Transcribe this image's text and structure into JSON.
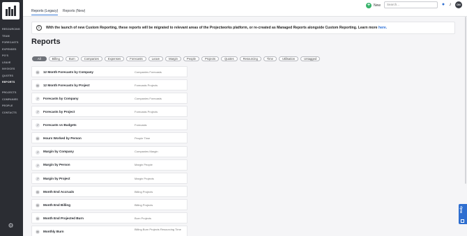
{
  "sidebar": {
    "logo": "pwl",
    "items": [
      {
        "label": "RESOURCING",
        "active": false
      },
      {
        "label": "TEAM",
        "active": false
      },
      {
        "label": "FORECASTS",
        "active": false
      },
      {
        "label": "EXPENSES",
        "active": false
      },
      {
        "label": "PO'S",
        "active": false
      },
      {
        "label": "LEAVE",
        "active": false
      },
      {
        "label": "INVOICES",
        "active": false
      },
      {
        "label": "QUOTES",
        "active": false
      },
      {
        "label": "REPORTS",
        "active": true
      }
    ],
    "items2": [
      {
        "label": "PROJECTS"
      },
      {
        "label": "COMPANIES"
      },
      {
        "label": "PEOPLE"
      },
      {
        "label": "CONTACTS"
      }
    ],
    "settings_icon": "gear-icon"
  },
  "tabs": [
    {
      "label": "Reports (Legacy)",
      "active": true
    },
    {
      "label": "Reports (New)",
      "active": false
    }
  ],
  "topbar": {
    "new_label": "New",
    "search_placeholder": "Search...",
    "user_initials": "DN"
  },
  "banner": {
    "text": "With the launch of new Custom Reporting, these reports will be migrated to relevant areas of the Projectworks platform, or re-created as Managed Reports alongside Custom Reporting. Learn more",
    "link": "here."
  },
  "page_title": "Reports",
  "filters": [
    "All",
    "Billing",
    "Burn",
    "Companies",
    "Expenses",
    "Forecasts",
    "Leave",
    "Margin",
    "People",
    "Projects",
    "Quotes",
    "Resourcing",
    "Time",
    "Utilisation",
    "Untagged"
  ],
  "reports": [
    {
      "name": "12 Month Forecasts by Company",
      "tags": "Companies   Forecasts",
      "icon": "table-icon"
    },
    {
      "name": "12 Month Forecasts by Project",
      "tags": "Forecasts   Projects",
      "icon": "table-icon"
    },
    {
      "name": "Forecasts by Company",
      "tags": "Companies   Forecasts",
      "icon": "chart-icon"
    },
    {
      "name": "Forecasts by Project",
      "tags": "Forecasts   Projects",
      "icon": "chart-icon"
    },
    {
      "name": "Forecasts vs Budgets",
      "tags": "Forecasts",
      "icon": "chart-icon"
    },
    {
      "name": "Hours Worked by Person",
      "tags": "People   Time",
      "icon": "table-icon"
    },
    {
      "name": "Margin by Company",
      "tags": "Companies   Margin",
      "icon": "chart-icon"
    },
    {
      "name": "Margin by Person",
      "tags": "Margin   People",
      "icon": "chart-icon"
    },
    {
      "name": "Margin by Project",
      "tags": "Margin   Projects",
      "icon": "chart-icon"
    },
    {
      "name": "Month End Accruals",
      "tags": "Billing   Projects",
      "icon": "table-icon"
    },
    {
      "name": "Month End Billing",
      "tags": "Billing   Projects",
      "icon": "table-icon"
    },
    {
      "name": "Month End Projected Burn",
      "tags": "Burn   Projects",
      "icon": "table-icon"
    },
    {
      "name": "Monthly Burn",
      "tags": "Billing   Burn   Projects   Resourcing   Time",
      "icon": "table-icon"
    }
  ],
  "help_label": "Help",
  "colors": {
    "sidebar": "#2b2d33",
    "accent": "#3c7dd6",
    "new": "#37b36a",
    "help": "#2f6fd0"
  }
}
